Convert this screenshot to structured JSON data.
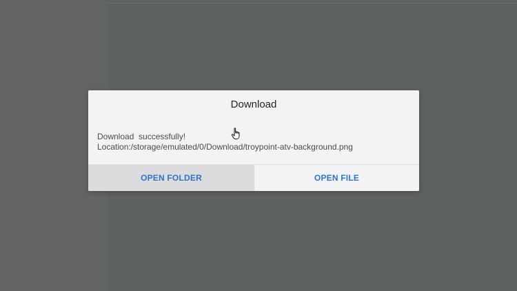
{
  "dialog": {
    "title": "Download",
    "message_line1": "Download  successfully!",
    "message_line2": "Location:/storage/emulated/0/Download/troypoint-atv-background.png",
    "buttons": {
      "open_folder": "OPEN FOLDER",
      "open_file": "OPEN FILE"
    }
  },
  "colors": {
    "backdrop": "#5f6263",
    "dialog_bg": "#f3f3f5",
    "button_text": "#2f73c9",
    "focused_button_bg": "#dcdcde"
  },
  "icons": {
    "pointer": "hand-pointer-icon"
  }
}
